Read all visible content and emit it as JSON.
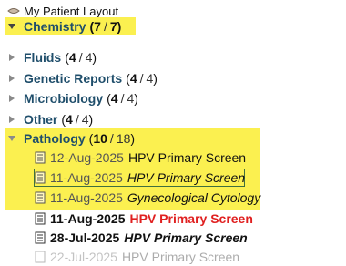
{
  "tree": {
    "root": {
      "label": "My Patient Layout",
      "icon": "layout-icon"
    },
    "folders": [
      {
        "name": "Chemistry",
        "count_shown": "7",
        "count_total": "7",
        "state": "expanded",
        "highlighted": true
      },
      {
        "name": "Fluids",
        "count_shown": "4",
        "count_total": "4",
        "state": "collapsed"
      },
      {
        "name": "Genetic Reports",
        "count_shown": "4",
        "count_total": "4",
        "state": "collapsed"
      },
      {
        "name": "Microbiology",
        "count_shown": "4",
        "count_total": "4",
        "state": "collapsed"
      },
      {
        "name": "Other",
        "count_shown": "4",
        "count_total": "4",
        "state": "collapsed"
      },
      {
        "name": "Pathology",
        "count_shown": "10",
        "count_total": "18",
        "state": "expanded",
        "highlighted": true
      }
    ],
    "pathology_documents": [
      {
        "date": "12-Aug-2025",
        "title": "HPV Primary Screen",
        "style": "regular",
        "highlighted": true
      },
      {
        "date": "11-Aug-2025",
        "title": "HPV Primary Screen",
        "style": "italic",
        "highlighted": true,
        "selected": true
      },
      {
        "date": "11-Aug-2025",
        "title": "Gynecological Cytology",
        "style": "italic",
        "highlighted": true
      },
      {
        "date": "11-Aug-2025",
        "title": "HPV Primary Screen",
        "style": "bold-red",
        "highlighted": false
      },
      {
        "date": "28-Jul-2025",
        "title": "HPV Primary Screen",
        "style": "bold-italic",
        "highlighted": false
      },
      {
        "date": "22-Jul-2025",
        "title": "HPV Primary Screen",
        "style": "partial",
        "highlighted": false
      }
    ]
  },
  "colors": {
    "highlight": "#fbf050",
    "folder_text": "#1f4e6b",
    "unread_red": "#e02020",
    "selection_border": "#3f6f3f"
  },
  "text": {
    "open_paren": "(",
    "slash": "/",
    "close_paren": ")"
  }
}
